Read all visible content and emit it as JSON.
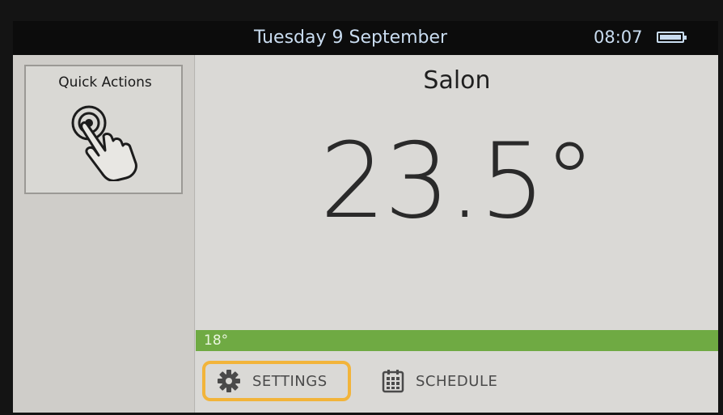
{
  "header": {
    "date": "Tuesday  9 September",
    "time": "08:07",
    "battery_icon": "battery-full-icon"
  },
  "sidebar": {
    "quick_actions": {
      "label": "Quick Actions",
      "icon": "touch-hand-icon"
    }
  },
  "main": {
    "room_name": "Salon",
    "current_temperature": "23.5°",
    "setpoint_label": "18°",
    "buttons": {
      "settings": {
        "label": "SETTINGS",
        "icon": "gear-icon",
        "highlighted": true
      },
      "schedule": {
        "label": "SCHEDULE",
        "icon": "calendar-icon"
      }
    }
  },
  "colors": {
    "accent_highlight": "#f2b43a",
    "setpoint_bar": "#6faa43",
    "header_text": "#c9dcf0"
  }
}
